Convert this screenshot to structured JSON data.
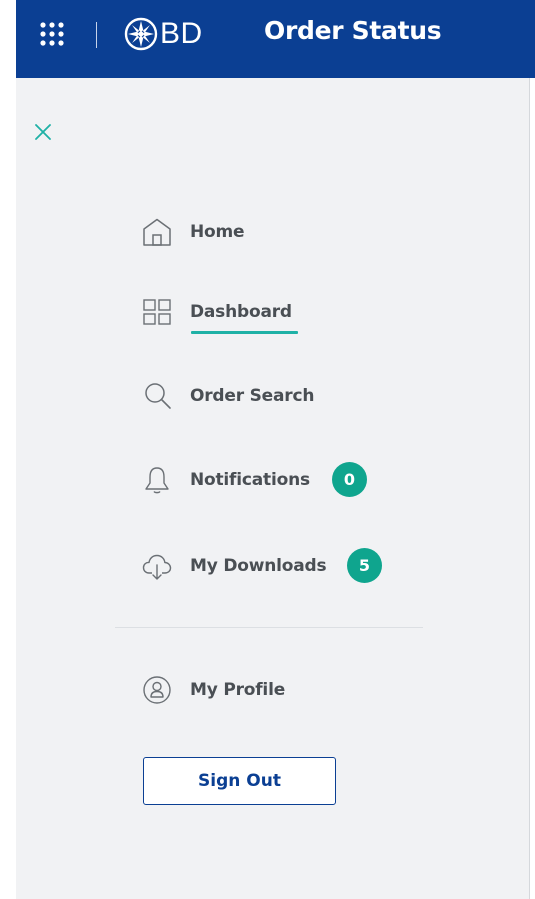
{
  "header": {
    "logo_text": "BD",
    "app_title": "Order Status",
    "apps_icon": "apps-grid-icon",
    "logo_icon": "bd-starburst-logo"
  },
  "nav": {
    "close_icon": "close-icon",
    "items": [
      {
        "id": "home",
        "label": "Home",
        "icon": "home-icon",
        "active": false
      },
      {
        "id": "dashboard",
        "label": "Dashboard",
        "icon": "dashboard-grid-icon",
        "active": true
      },
      {
        "id": "order-search",
        "label": "Order Search",
        "icon": "search-icon",
        "active": false
      },
      {
        "id": "notifications",
        "label": "Notifications",
        "icon": "bell-icon",
        "active": false,
        "badge": "0"
      },
      {
        "id": "my-downloads",
        "label": "My Downloads",
        "icon": "cloud-download-icon",
        "active": false,
        "badge": "5"
      }
    ],
    "profile": {
      "label": "My Profile",
      "icon": "user-circle-icon"
    },
    "signout_label": "Sign Out"
  },
  "colors": {
    "header_bg": "#0b3f93",
    "panel_bg": "#f1f2f4",
    "accent": "#1fb1a6",
    "badge_bg": "#0fa58e",
    "text": "#4a4f54"
  }
}
